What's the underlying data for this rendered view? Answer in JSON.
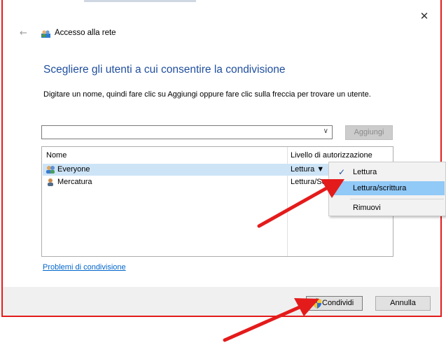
{
  "window": {
    "title": "Accesso alla rete",
    "close_glyph": "✕",
    "back_glyph": "←"
  },
  "heading": "Scegliere gli utenti a cui consentire la condivisione",
  "instructions": "Digitare un nome, quindi fare clic su Aggiungi oppure fare clic sulla freccia per trovare un utente.",
  "user_input": {
    "value": "",
    "arrow_glyph": "∨"
  },
  "add_button": {
    "label": "Aggiungi"
  },
  "table": {
    "headers": {
      "name": "Nome",
      "level": "Livello di autorizzazione"
    },
    "rows": [
      {
        "name": "Everyone",
        "level": "Lettura ▼",
        "icon": "group-users-icon"
      },
      {
        "name": "Mercatura",
        "level": "Lettura/Sc",
        "icon": "user-icon"
      }
    ]
  },
  "sharing_problems_link": "Problemi di condivisione",
  "footer": {
    "share_label": "Condividi",
    "share_icon": "uac-shield-icon",
    "cancel_label": "Annulla"
  },
  "permission_menu": {
    "check_glyph": "✓",
    "items": [
      {
        "label": "Lettura",
        "checked": true
      },
      {
        "label": "Lettura/scrittura",
        "highlighted": true
      },
      {
        "label": "Rimuovi"
      }
    ]
  },
  "colors": {
    "heading": "#1f4e9e",
    "link": "#0066cc",
    "selection": "#cde4f7",
    "menu_highlight": "#91c9f7",
    "annotation_red": "#e41b1b"
  }
}
